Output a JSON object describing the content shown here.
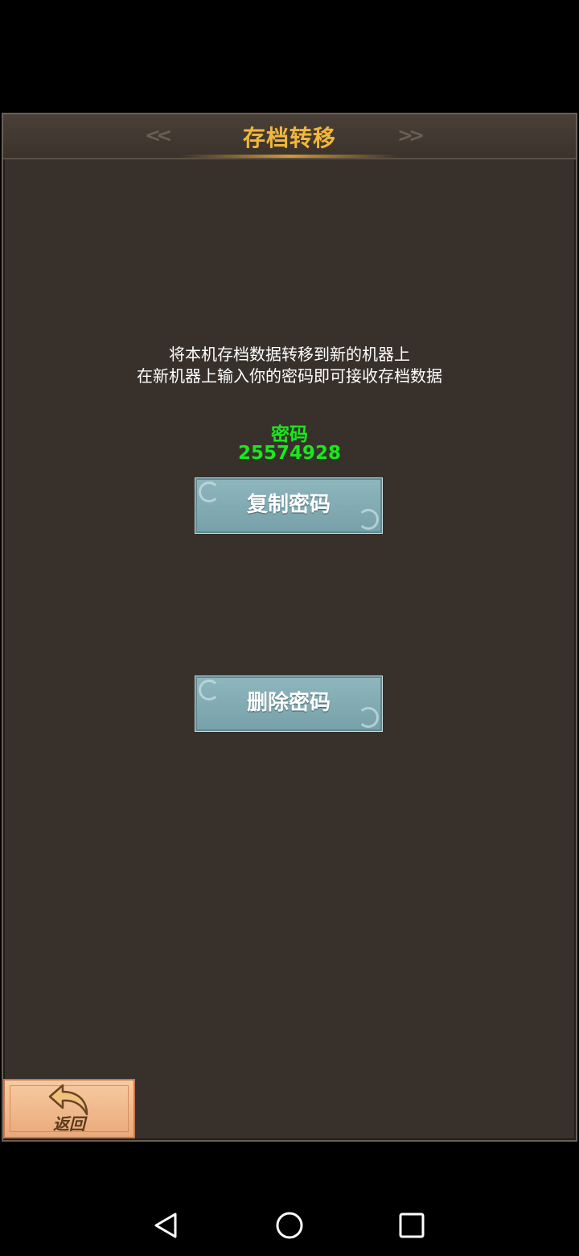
{
  "header": {
    "title": "存档转移",
    "left_decoration": "<<",
    "right_decoration": ">>"
  },
  "description": {
    "line1": "将本机存档数据转移到新的机器上",
    "line2": "在新机器上输入你的密码即可接收存档数据"
  },
  "password": {
    "label": "密码",
    "value": "25574928"
  },
  "buttons": {
    "copy_label": "复制密码",
    "delete_label": "删除密码",
    "back_label": "返回"
  },
  "colors": {
    "title": "#f2b63a",
    "password": "#19e81d",
    "panel_bg": "#37302b",
    "button_bg": "#82acb4"
  },
  "icons": {
    "back": "return-arrow-icon",
    "nav_back": "triangle-back-icon",
    "nav_home": "circle-home-icon",
    "nav_recent": "square-recent-icon"
  }
}
